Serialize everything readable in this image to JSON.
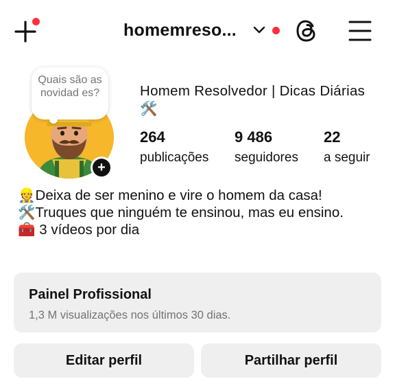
{
  "header": {
    "username": "homemreso...",
    "icons": {
      "create": "plus-icon",
      "account_switcher": "chevron-down-icon",
      "threads": "threads-icon",
      "menu": "hamburger-menu-icon"
    },
    "notification_dot_color": "#ff2d3d"
  },
  "profile": {
    "note": "Quais são as novidad es?",
    "display_name_text": "Homem Resolvedor | Dicas Diárias",
    "display_name_emoji": "🛠️",
    "add_story_symbol": "+",
    "stats": [
      {
        "value": "264",
        "label": "publicações"
      },
      {
        "value": "9 486",
        "label": "seguidores"
      },
      {
        "value": "22",
        "label": "a seguir"
      }
    ]
  },
  "bio": {
    "lines": [
      {
        "emoji": "👷",
        "text": "Deixa de ser menino e vire o homem da casa!"
      },
      {
        "emoji": "🛠️",
        "text": "Truques que ninguém te ensinou, mas eu ensino."
      },
      {
        "emoji": "🧰",
        "text": " 3 vídeos por dia"
      }
    ]
  },
  "professional_dashboard": {
    "title": "Painel Profissional",
    "subtitle": "1,3 M visualizações nos últimos 30 dias."
  },
  "actions": {
    "edit_label": "Editar perfil",
    "share_label": "Partilhar perfil"
  },
  "colors": {
    "button_bg": "#efefef",
    "secondary_text": "#737373",
    "accent_dot": "#ff2d3d"
  }
}
